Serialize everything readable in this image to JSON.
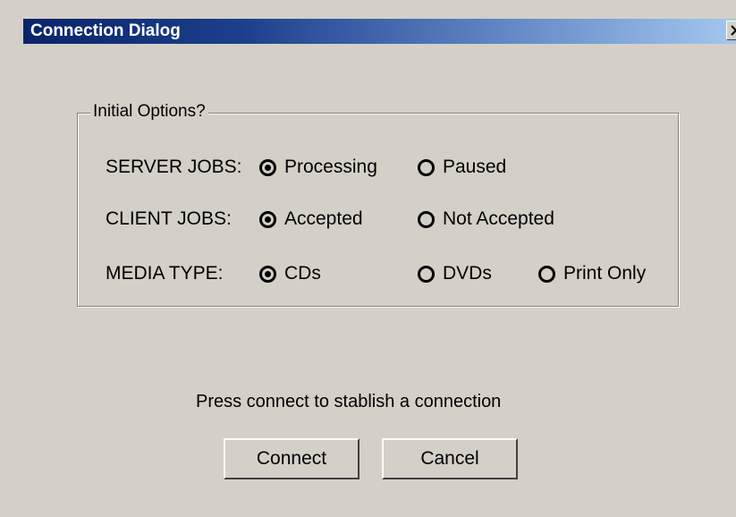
{
  "window": {
    "title": "Connection Dialog",
    "close_symbol": "close-icon"
  },
  "group": {
    "legend": "Initial Options?",
    "rows": [
      {
        "label": "SERVER JOBS:",
        "options": [
          {
            "label": "Processing",
            "checked": true
          },
          {
            "label": "Paused",
            "checked": false
          }
        ]
      },
      {
        "label": "CLIENT JOBS:",
        "options": [
          {
            "label": "Accepted",
            "checked": true
          },
          {
            "label": "Not Accepted",
            "checked": false
          }
        ]
      },
      {
        "label": "MEDIA TYPE:",
        "options": [
          {
            "label": "CDs",
            "checked": true
          },
          {
            "label": "DVDs",
            "checked": false
          },
          {
            "label": "Print Only",
            "checked": false
          }
        ]
      }
    ]
  },
  "status_text": "Press connect to stablish a connection",
  "buttons": {
    "connect": "Connect",
    "cancel": "Cancel"
  },
  "colors": {
    "dialog_bg": "#d4d0c8",
    "title_start": "#0a246a",
    "title_end": "#a6caf0"
  }
}
